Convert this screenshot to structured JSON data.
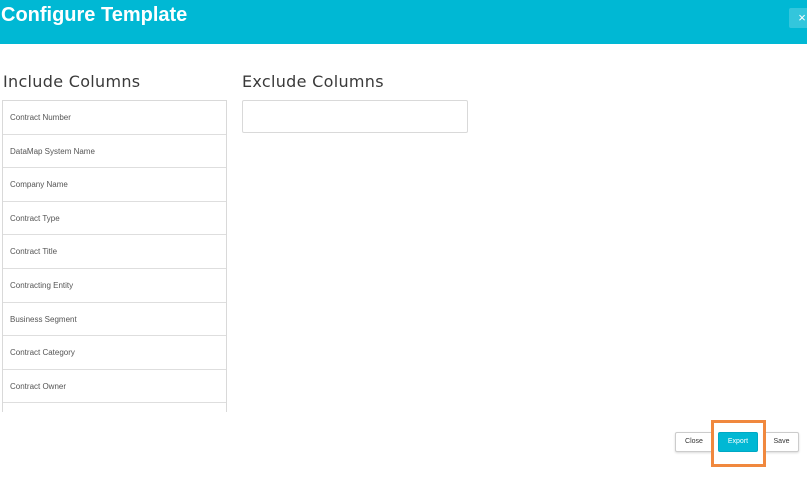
{
  "header": {
    "title": "Configure Template",
    "close_glyph": "×",
    "background": "#00b8d4"
  },
  "include": {
    "label": "Include Columns",
    "items": [
      "Contract Number",
      "DataMap System Name",
      "Company Name",
      "Contract Type",
      "Contract Title",
      "Contracting Entity",
      "Business Segment",
      "Contract Category",
      "Contract Owner",
      ""
    ]
  },
  "exclude": {
    "label": "Exclude Columns",
    "items": []
  },
  "footer": {
    "close_label": "Close",
    "export_label": "Export",
    "save_label": "Save",
    "highlight_color": "#f0883e"
  }
}
